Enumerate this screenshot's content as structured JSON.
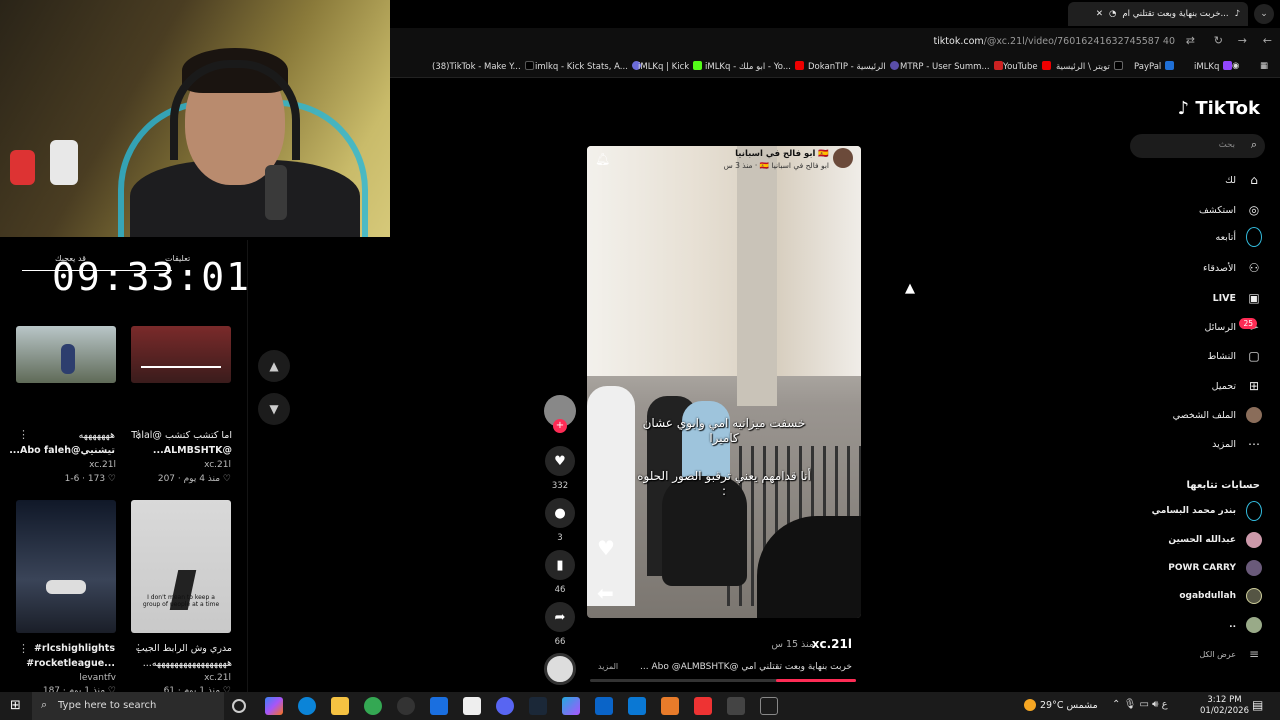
{
  "timer": {
    "value": "09:33:01",
    "label_left": "قد يعجبك",
    "label_right": "تعليقات"
  },
  "grid": {
    "items": [
      {
        "title": "هههههههه",
        "author_line": "تيشنيي@Abo faleh...",
        "channel": "xc.21l",
        "stats": "1-6 · 173 ♡"
      },
      {
        "title": "اما كتشب كتشب @Talal",
        "author_line": "@ALMBSHTK...",
        "channel": "xc.21l",
        "stats": "منذ 4 يوم · 207 ♡"
      },
      {
        "title": "#rlcshighlights",
        "author_line": "#rocketleague...",
        "channel": "levantfv",
        "stats": "منذ 1 يوم · 187 ♡"
      },
      {
        "title": "مدري وش الرابط الجيب",
        "author_line": "هههههههههههههههههه...",
        "channel": "xc.21l",
        "stats": "منذ 1 يوم · 61 ♡"
      }
    ],
    "thumb_caption": "I don't mean to keep a group of people at a time"
  },
  "browser": {
    "tab_title": "خربت بنهاية وبعت تقتلني ام...",
    "url_domain": "tiktok.com",
    "url_path": "/@xc.21l/video/76016241632745587 40",
    "bookmarks": [
      "(38)TikTok - Make Y...",
      "imlkq - Kick Stats, A...",
      "iMLKq | Kick",
      "iMLKq - ابو ملك - Yo...",
      "DokanTIP - الرئيسية",
      "MTRP - User Summ...",
      "YouTube",
      "تويتر \\ الرئيسية",
      "PayPal",
      "iMLKq"
    ]
  },
  "tiktok": {
    "logo": "TikTok",
    "search_placeholder": "بحث",
    "nav": [
      {
        "label": "لك",
        "icon": "home-icon"
      },
      {
        "label": "استكشف",
        "icon": "compass-icon"
      },
      {
        "label": "أتابعه",
        "icon": "following-icon"
      },
      {
        "label": "الأصدقاء",
        "icon": "friends-icon"
      },
      {
        "label": "LIVE",
        "icon": "live-icon"
      },
      {
        "label": "الرسائل",
        "icon": "messages-icon"
      },
      {
        "label": "النشاط",
        "icon": "activity-icon"
      },
      {
        "label": "تحميل",
        "icon": "upload-icon"
      },
      {
        "label": "الملف الشخصي",
        "icon": "profile-icon"
      },
      {
        "label": "المزيد",
        "icon": "more-icon"
      }
    ],
    "messages_badge": "25",
    "following_header": "حسابات تتابعها",
    "following": [
      "بندر محمد البسامي",
      "عبدالله الحسين",
      "POWR CARRY",
      "ogabdullah",
      ".."
    ],
    "see_all": "عرض الكل"
  },
  "video": {
    "account": "ابو فالح في اسبانيا 🇪🇸",
    "account_sub": "منذ 3 س · 🇪🇸 ابو فالح في اسبانيا",
    "caption_1": "خسفت ميزانيه امي وابوي عشان كاميرا",
    "caption_2": "أنا قدامهم يعني ترقبو الصور الحلوه :",
    "likes": "332",
    "comments": "3",
    "saves": "46",
    "shares": "66",
    "author": "xc.21l",
    "posted": "منذ 15 س",
    "description": "خربت بنهاية وبعت تقتلني امي @Abo @ALMBSHTK ...",
    "more": "المزيد",
    "progress": 0.3
  },
  "taskbar": {
    "search_placeholder": "Type here to search",
    "weather": "29°C مشمس",
    "time": "3:12 PM",
    "date": "01/02/2026",
    "lang": "ع"
  }
}
